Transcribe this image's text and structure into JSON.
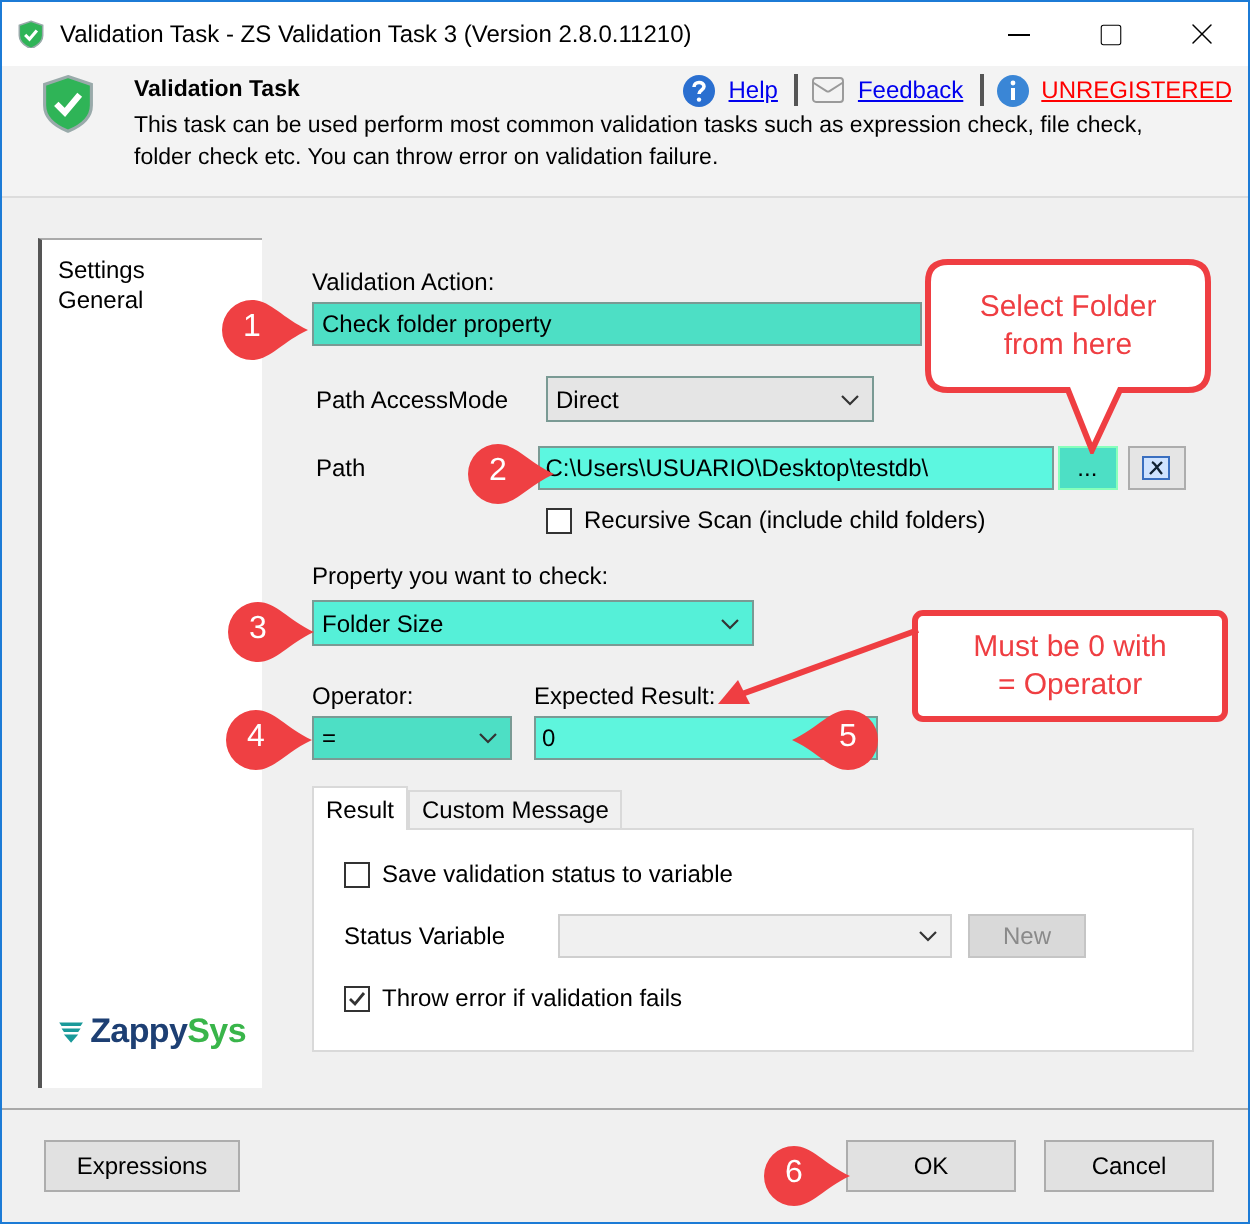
{
  "window": {
    "title": "Validation Task - ZS Validation Task 3 (Version 2.8.0.11210)"
  },
  "header": {
    "title": "Validation Task",
    "description": "This task can be used perform most common validation tasks such as expression check, file check, folder check etc. You can throw error on validation failure.",
    "links": [
      {
        "label": "Help",
        "kind": "help"
      },
      {
        "label": "Feedback",
        "kind": "feedback"
      },
      {
        "label": "UNREGISTERED",
        "kind": "info"
      }
    ]
  },
  "sidebar": {
    "items": [
      {
        "label": "Settings"
      },
      {
        "label": "General"
      }
    ]
  },
  "form": {
    "validation_action": {
      "label": "Validation Action:",
      "value": "Check folder property"
    },
    "path_access_mode": {
      "label": "Path AccessMode",
      "value": "Direct"
    },
    "path": {
      "label": "Path",
      "value": "C:\\Users\\USUARIO\\Desktop\\testdb\\",
      "browse": "..."
    },
    "recursive": {
      "label": "Recursive Scan (include child folders)",
      "checked": false
    },
    "property": {
      "label": "Property you want to check:",
      "value": "Folder Size"
    },
    "operator": {
      "label": "Operator:",
      "value": "="
    },
    "expected_result": {
      "label": "Expected Result:",
      "value": "0"
    }
  },
  "tabs": [
    {
      "label": "Result",
      "selected": true
    },
    {
      "label": "Custom Message",
      "selected": false
    }
  ],
  "result": {
    "save_status": {
      "label": "Save validation status to variable",
      "checked": false
    },
    "status_variable": {
      "label": "Status Variable",
      "disabled": true
    },
    "new_button": {
      "label": "New",
      "disabled": true
    },
    "throw_error": {
      "label": "Throw error if validation fails",
      "checked": true
    }
  },
  "logo": {
    "parts": [
      "Zappy",
      "Sys"
    ]
  },
  "buttons": [
    {
      "label": "Expressions"
    },
    {
      "label": "OK"
    },
    {
      "label": "Cancel"
    }
  ],
  "annotations": {
    "markers": [
      "1",
      "2",
      "3",
      "4",
      "5",
      "6"
    ],
    "callouts": [
      "Select Folder\nfrom here",
      "Must be 0 with\n= Operator"
    ]
  }
}
